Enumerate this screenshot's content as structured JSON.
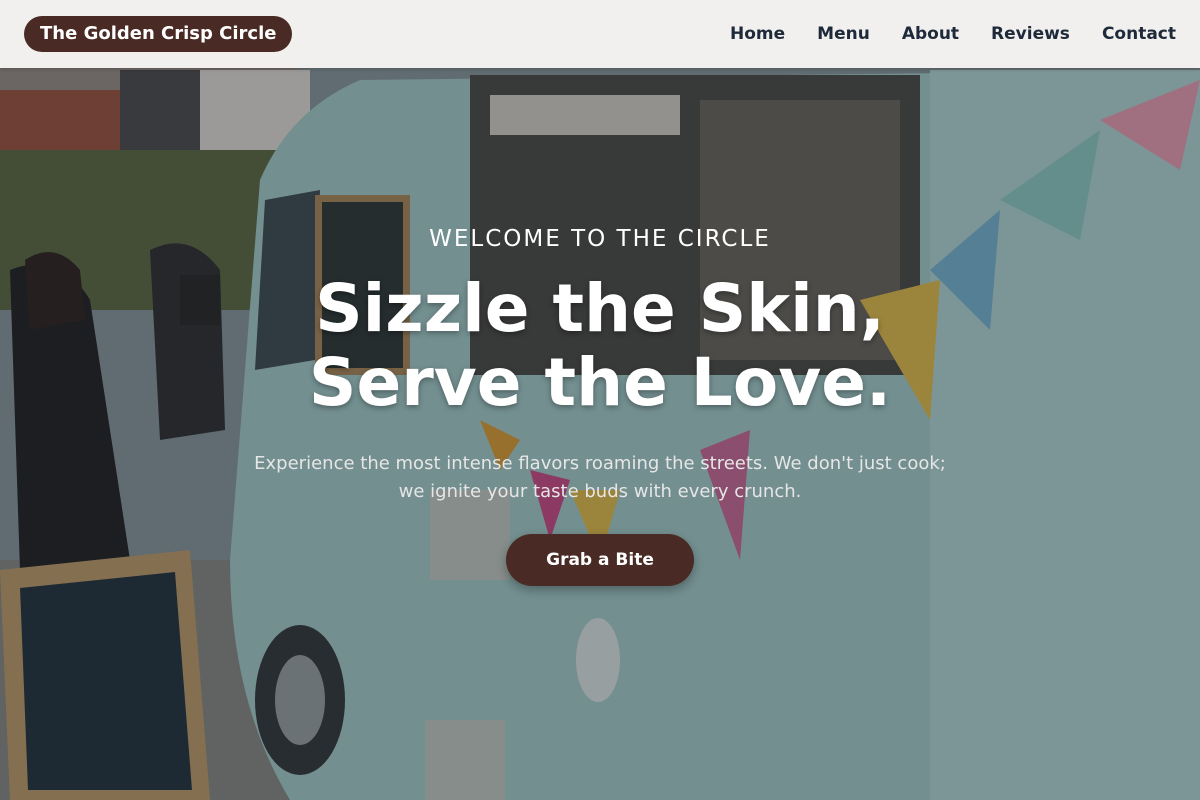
{
  "header": {
    "brand": "The Golden Crisp Circle",
    "nav": [
      "Home",
      "Menu",
      "About",
      "Reviews",
      "Contact"
    ]
  },
  "hero": {
    "eyebrow": "WELCOME TO THE CIRCLE",
    "headline_line1": "Sizzle the Skin,",
    "headline_line2": "Serve the Love.",
    "subtext": "Experience the most intense flavors roaming the streets. We don't just cook; we ignite your taste buds with every crunch.",
    "cta": "Grab a Bite",
    "background_description": "food-truck-photo"
  },
  "colors": {
    "brand_bg": "#4a2a24",
    "header_bg": "#f1f0ee",
    "nav_text": "#1e2a3a",
    "hero_text": "#ffffff"
  }
}
